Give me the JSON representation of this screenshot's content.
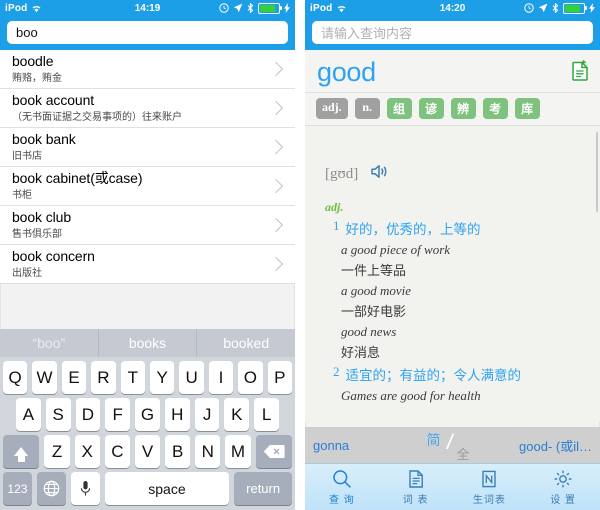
{
  "colors": {
    "accent_blue": "#1d9fe8",
    "headword_blue": "#2ea3f2",
    "tag_green": "#7ec27e",
    "tag_gray": "#a0a0a0",
    "pos_green": "#6cbf3f",
    "battery_green": "#34d13b"
  },
  "left_panel": {
    "status": {
      "carrier": "iPod",
      "wifi_icon": "wifi-icon",
      "time": "14:19",
      "icons": [
        "alarm-clock-icon",
        "location-arrow-icon",
        "bluetooth-icon",
        "battery-icon",
        "charging-bolt-icon"
      ]
    },
    "search": {
      "value": "boo",
      "placeholder": ""
    },
    "suggestions": [
      {
        "word": "boodle",
        "def": "贿赂，贿金"
      },
      {
        "word": "book account",
        "def": "（无书面证据之交易事项的）往来账户"
      },
      {
        "word": "book bank",
        "def": "旧书店"
      },
      {
        "word": "book cabinet(或case)",
        "def": "书柜"
      },
      {
        "word": "book club",
        "def": "售书俱乐部"
      },
      {
        "word": "book concern",
        "def": "出版社"
      }
    ],
    "keyboard": {
      "autocorrect": [
        "“boo”",
        "books",
        "booked"
      ],
      "row1": [
        "Q",
        "W",
        "E",
        "R",
        "T",
        "Y",
        "U",
        "I",
        "O",
        "P"
      ],
      "row2": [
        "A",
        "S",
        "D",
        "F",
        "G",
        "H",
        "J",
        "K",
        "L"
      ],
      "row3": [
        "Z",
        "X",
        "C",
        "V",
        "B",
        "N",
        "M"
      ],
      "shift_icon": "shift-icon",
      "backspace_icon": "backspace-icon",
      "numbers_key": "123",
      "globe_icon": "globe-icon",
      "mic_icon": "microphone-icon",
      "space_key": "space",
      "return_key": "return"
    }
  },
  "right_panel": {
    "status": {
      "carrier": "iPod",
      "wifi_icon": "wifi-icon",
      "time": "14:20",
      "icons": [
        "alarm-clock-icon",
        "location-arrow-icon",
        "bluetooth-icon",
        "battery-icon",
        "charging-bolt-icon"
      ]
    },
    "search": {
      "value": "",
      "placeholder": "请输入查询内容"
    },
    "headword": "good",
    "add_note_icon": "add-document-icon",
    "tags": [
      {
        "label": "adj.",
        "style": "gray"
      },
      {
        "label": "n.",
        "style": "gray"
      },
      {
        "label": "组",
        "style": "green"
      },
      {
        "label": "谚",
        "style": "green"
      },
      {
        "label": "辨",
        "style": "green"
      },
      {
        "label": "考",
        "style": "green"
      },
      {
        "label": "库",
        "style": "green"
      }
    ],
    "phonetic": "[gʊd]",
    "speaker_icon": "speaker-icon",
    "part_of_speech": "adj.",
    "senses": [
      {
        "num": "1",
        "definition": "好的，优秀的，上等的",
        "examples": [
          {
            "en": "a good piece of work",
            "zh": "一件上等品"
          },
          {
            "en": "a good movie",
            "zh": "一部好电影"
          },
          {
            "en": "good news",
            "zh": "好消息"
          }
        ]
      },
      {
        "num": "2",
        "definition": "适宜的；有益的；令人满意的",
        "examples": [
          {
            "en": "Games are good for health",
            "zh": ""
          }
        ]
      }
    ],
    "related": {
      "prev": "gonna",
      "next": "good- (或il…",
      "toggle_simplified": "简",
      "toggle_full": "全"
    },
    "tabs": [
      {
        "label": "查 询",
        "icon": "search-icon",
        "active": true
      },
      {
        "label": "词 表",
        "icon": "wordlist-icon",
        "active": false
      },
      {
        "label": "生词表",
        "icon": "newword-icon",
        "active": false
      },
      {
        "label": "设 置",
        "icon": "gear-icon",
        "active": false
      }
    ]
  }
}
